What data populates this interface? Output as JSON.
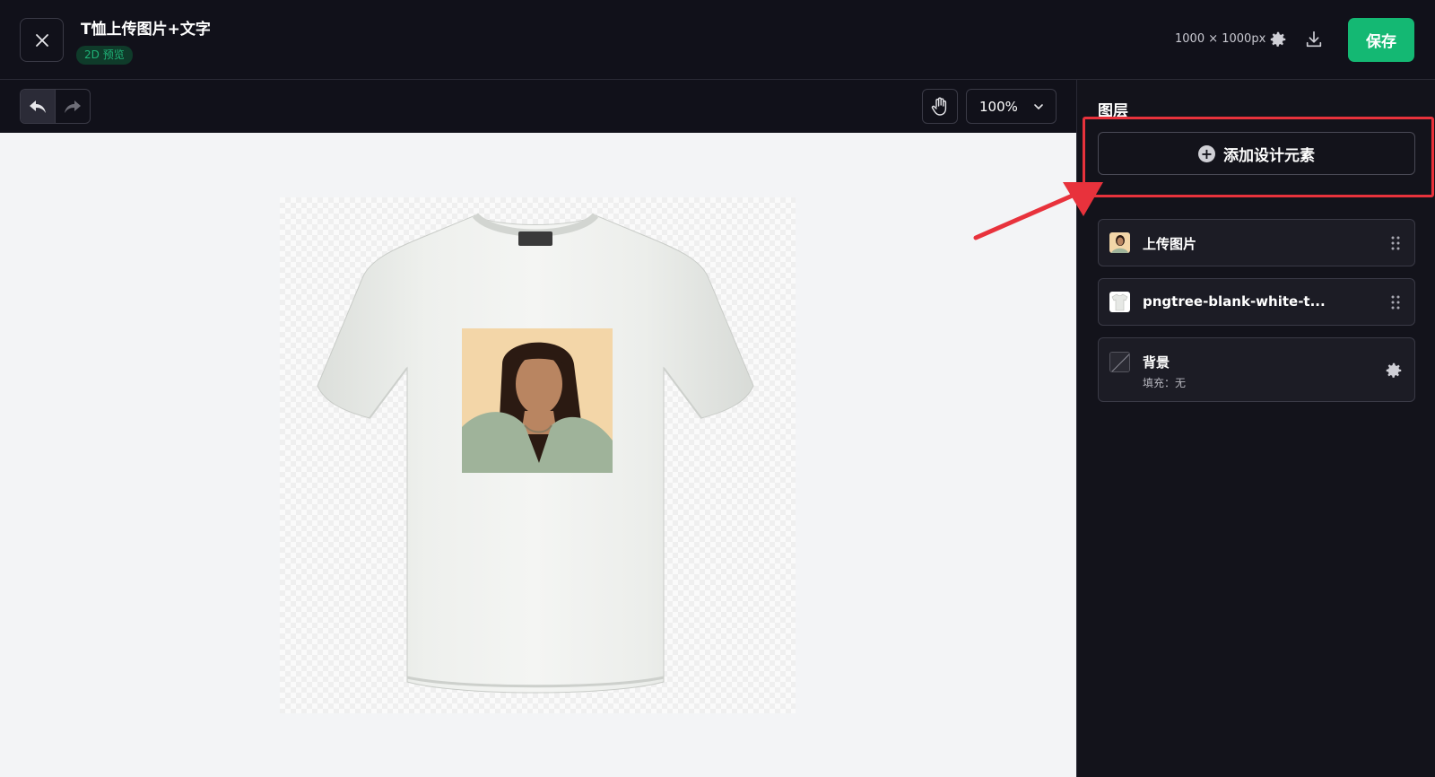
{
  "header": {
    "title": "T恤上传图片+文字",
    "badge": "2D 预览",
    "dimensions": "1000 × 1000px",
    "save_label": "保存"
  },
  "toolbar": {
    "zoom": "100%"
  },
  "panel": {
    "title": "图层",
    "add_button": "添加设计元素",
    "layers": [
      {
        "name": "上传图片",
        "icon": "photo-thumbnail"
      },
      {
        "name": "pngtree-blank-white-t...",
        "icon": "tshirt-thumbnail"
      },
      {
        "name": "背景",
        "sub": "填充：无",
        "icon": "empty-fill-swatch"
      }
    ]
  },
  "colors": {
    "accent": "#14b873",
    "highlight": "#e8323c",
    "badge_text": "#1fb277",
    "badge_bg": "#0f3b2a"
  }
}
